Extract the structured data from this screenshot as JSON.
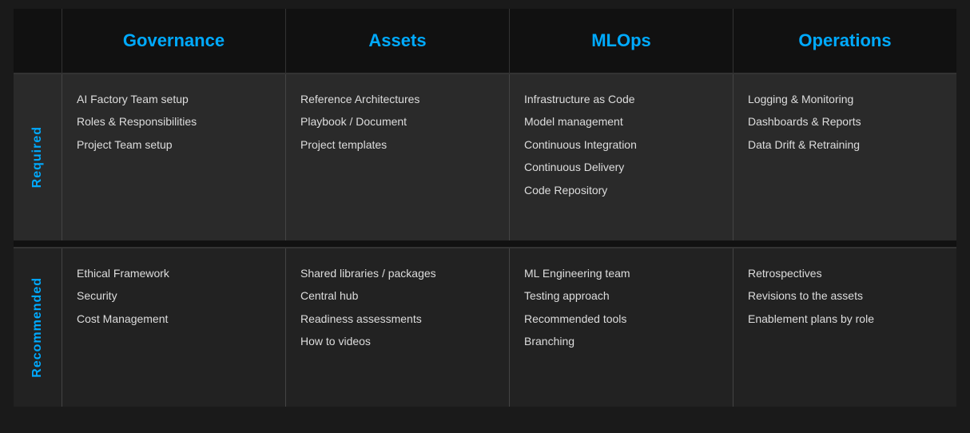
{
  "headers": {
    "col1": "Governance",
    "col2": "Assets",
    "col3": "MLOps",
    "col4": "Operations"
  },
  "required": {
    "label": "Required",
    "governance": [
      "AI Factory Team setup",
      "Roles & Responsibilities",
      "Project Team setup"
    ],
    "assets": [
      "Reference Architectures",
      "Playbook / Document",
      "Project templates"
    ],
    "mlops": [
      "Infrastructure as Code",
      "Model management",
      "Continuous Integration",
      "Continuous Delivery",
      "Code Repository"
    ],
    "operations": [
      "Logging & Monitoring",
      "Dashboards & Reports",
      "Data Drift & Retraining"
    ]
  },
  "recommended": {
    "label": "Recommended",
    "governance": [
      "Ethical Framework",
      "Security",
      "Cost Management"
    ],
    "assets": [
      "Shared libraries / packages",
      "Central hub",
      "Readiness assessments",
      "How to videos"
    ],
    "mlops": [
      "ML Engineering team",
      "Testing approach",
      "Recommended tools",
      "Branching"
    ],
    "operations": [
      "Retrospectives",
      "Revisions to the assets",
      "Enablement plans by role"
    ]
  }
}
